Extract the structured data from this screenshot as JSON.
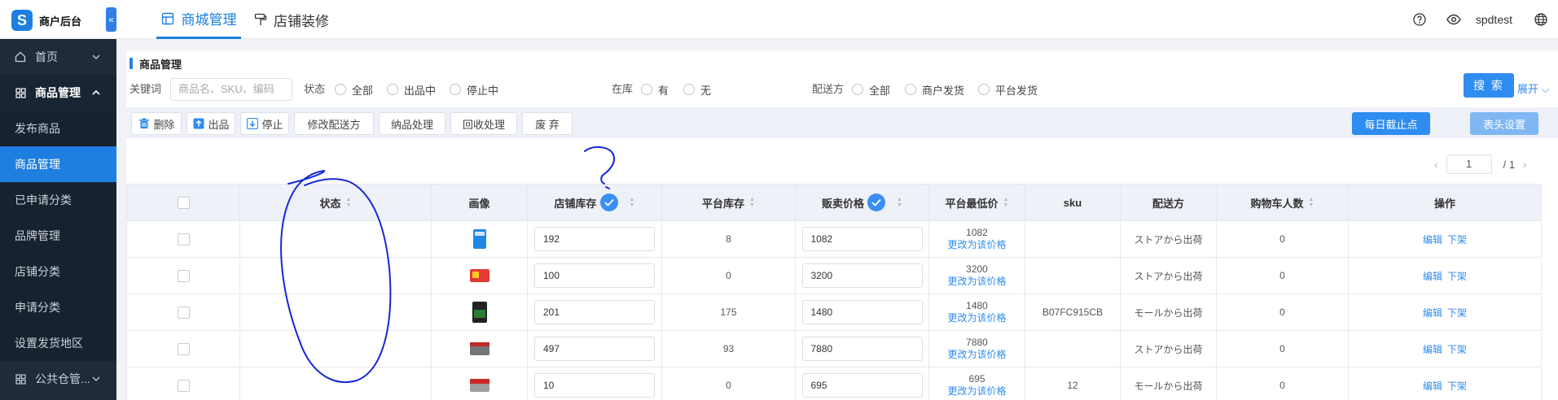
{
  "app": {
    "logo_text": "商户后台"
  },
  "top_tabs": [
    {
      "label": "商城管理",
      "icon": "store-icon",
      "active": true
    },
    {
      "label": "店铺装修",
      "icon": "paint-roller-icon",
      "active": false
    }
  ],
  "top_right": {
    "username": "spdtest",
    "icons": [
      "help-icon",
      "eye-icon",
      "globe-icon"
    ]
  },
  "sidebar": {
    "home": "首页",
    "product_group": "商品管理",
    "sub_items": [
      "发布商品",
      "商品管理",
      "已申请分类",
      "品牌管理",
      "店铺分类",
      "申请分类",
      "设置发货地区"
    ],
    "active_sub": "商品管理",
    "public_warehouse": "公共仓管..."
  },
  "section_title": "商品管理",
  "filters": {
    "keyword_label": "关键词",
    "keyword_placeholder": "商品名、SKU、编码",
    "status_label": "状态",
    "status_options": [
      "全部",
      "出品中",
      "停止中"
    ],
    "stock_label": "在库",
    "stock_options": [
      "有",
      "无"
    ],
    "delivery_label": "配送方",
    "delivery_options": [
      "全部",
      "商户发货",
      "平台发货"
    ],
    "search_button": "搜 索",
    "expand_label": "展开"
  },
  "toolbar": {
    "delete": "删除",
    "publish": "出品",
    "stop": "停止",
    "modify_delivery": "修改配送方",
    "inbound": "纳品处理",
    "recycle": "回收处理",
    "discard": "废 弃",
    "daily_cutoff": "每日截止点",
    "header_settings": "表头设置"
  },
  "pager": {
    "current": "1",
    "total": "/ 1"
  },
  "table": {
    "headers": [
      "状态",
      "画像",
      "店铺库存",
      "平台库存",
      "贩卖价格",
      "平台最低价",
      "sku",
      "配送方",
      "购物车人数",
      "操作"
    ],
    "rows": [
      {
        "status": "",
        "shop_stock": "192",
        "platform_stock": "8",
        "price": "1082",
        "min_price": "1082",
        "min_price_link": "更改为该价格",
        "sku": "",
        "delivery": "ストアから出荷",
        "cart": "0",
        "edit": "编辑",
        "remove": "下架",
        "thumb_color": "#1e88e5"
      },
      {
        "status": "",
        "shop_stock": "100",
        "platform_stock": "0",
        "price": "3200",
        "min_price": "3200",
        "min_price_link": "更改为该价格",
        "sku": "",
        "delivery": "ストアから出荷",
        "cart": "0",
        "edit": "编辑",
        "remove": "下架",
        "thumb_color": "#e53935"
      },
      {
        "status": "",
        "shop_stock": "201",
        "platform_stock": "175",
        "price": "1480",
        "min_price": "1480",
        "min_price_link": "更改为该价格",
        "sku": "B07FC915CB",
        "delivery": "モールから出荷",
        "cart": "0",
        "edit": "编辑",
        "remove": "下架",
        "thumb_color": "#2e7d32"
      },
      {
        "status": "",
        "shop_stock": "497",
        "platform_stock": "93",
        "price": "7880",
        "min_price": "7880",
        "min_price_link": "更改为该价格",
        "sku": "",
        "delivery": "ストアから出荷",
        "cart": "0",
        "edit": "编辑",
        "remove": "下架",
        "thumb_color": "#757575"
      },
      {
        "status": "",
        "shop_stock": "10",
        "platform_stock": "0",
        "price": "695",
        "min_price": "695",
        "min_price_link": "更改为该价格",
        "sku": "12",
        "delivery": "モールから出荷",
        "cart": "0",
        "edit": "编辑",
        "remove": "下架",
        "thumb_color": "#c62828"
      }
    ]
  },
  "colors": {
    "accent": "#2f8cf0",
    "sidebar_bg": "#1f2b3a",
    "active_menu": "#1e7fe0",
    "annotation_ink": "#1428d6"
  }
}
